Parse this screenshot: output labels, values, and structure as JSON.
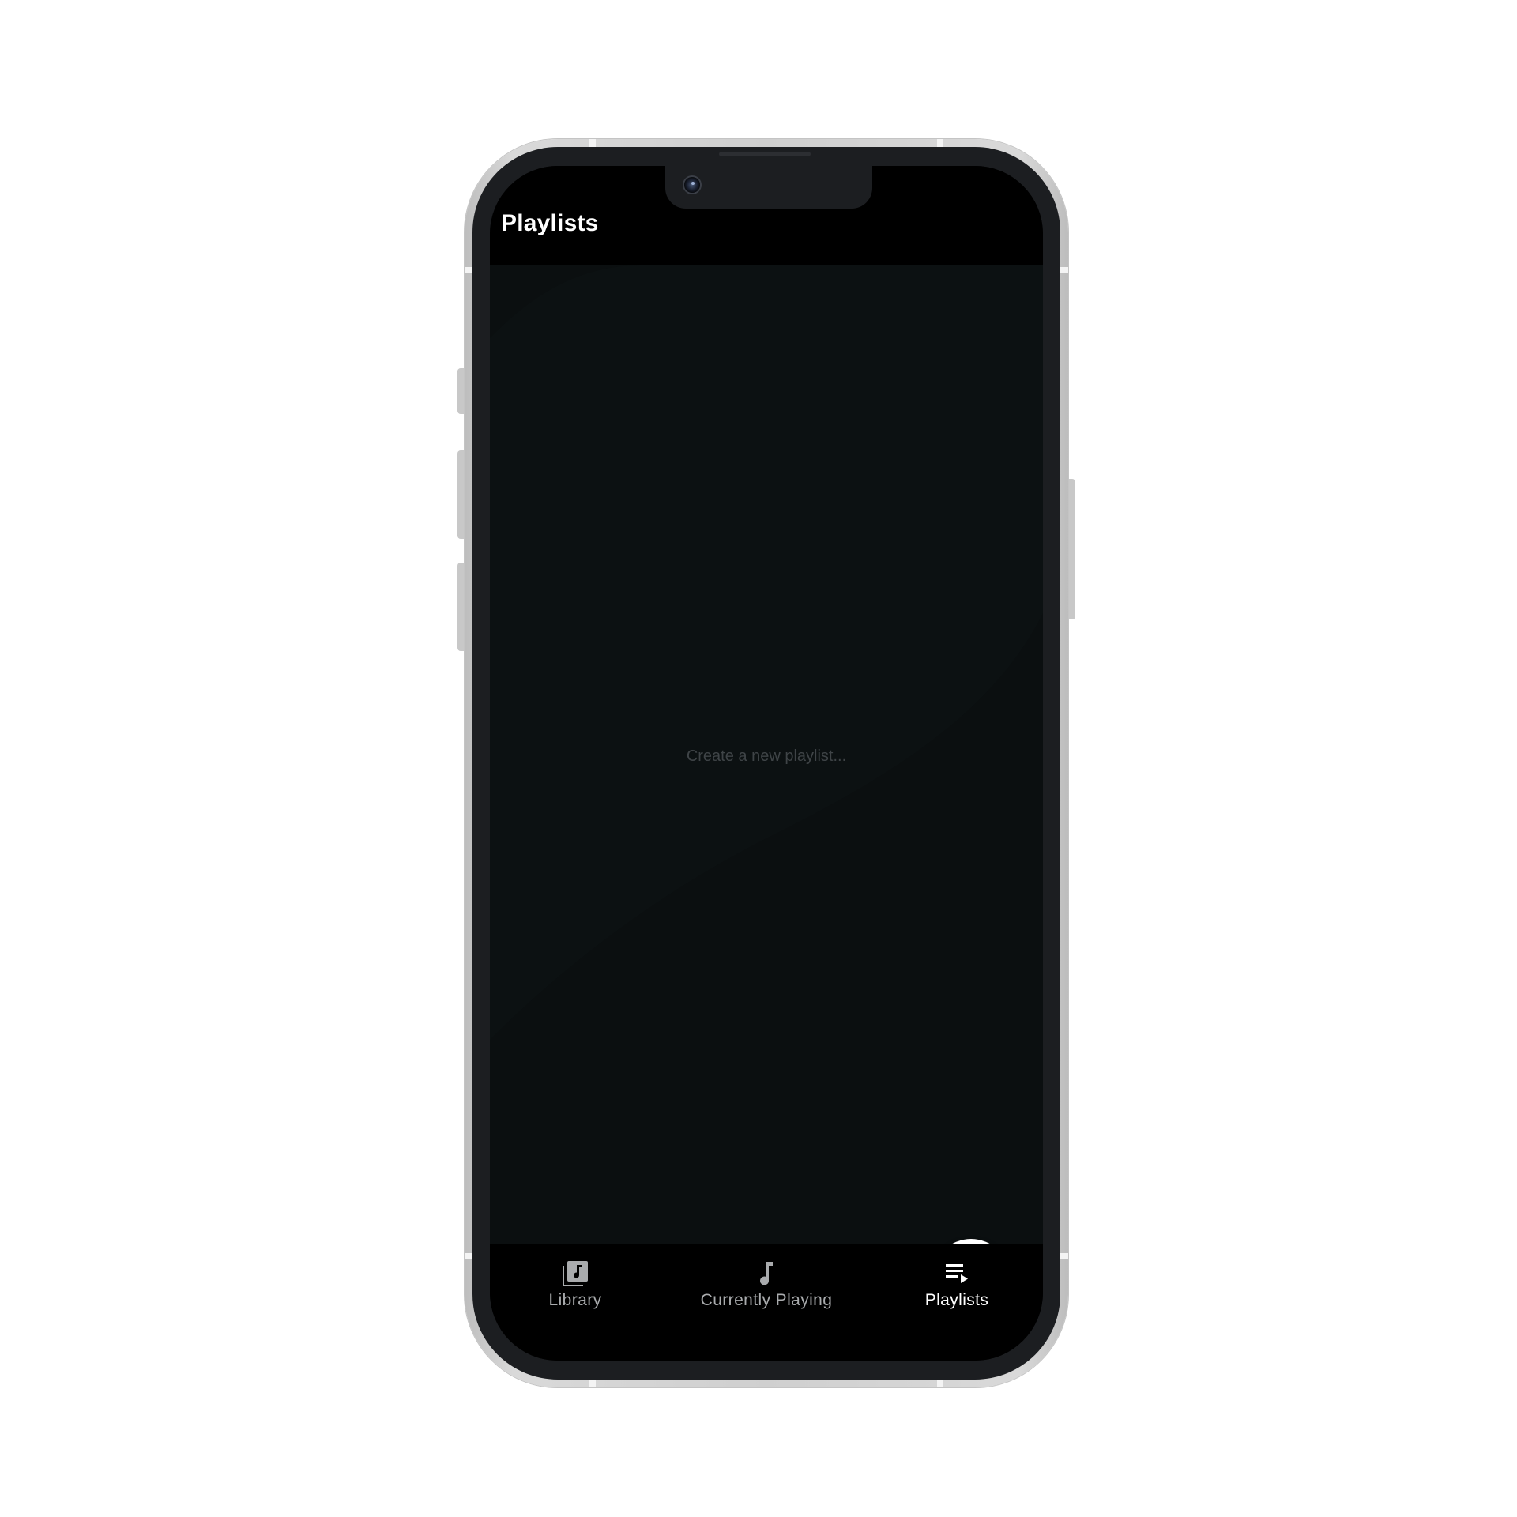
{
  "header": {
    "title": "Playlists"
  },
  "main": {
    "empty_message": "Create a new playlist...",
    "fab_icon": "plus-icon"
  },
  "bottom_nav": {
    "items": [
      {
        "label": "Library",
        "icon": "library-music-icon",
        "active": false
      },
      {
        "label": "Currently Playing",
        "icon": "music-note-icon",
        "active": false
      },
      {
        "label": "Playlists",
        "icon": "playlist-play-icon",
        "active": true
      }
    ]
  },
  "colors": {
    "screen_background": "#000000",
    "content_background": "#0b0f10",
    "active_label": "#ffffff",
    "inactive_label": "#a9abad",
    "fab_background": "#ffffff"
  }
}
